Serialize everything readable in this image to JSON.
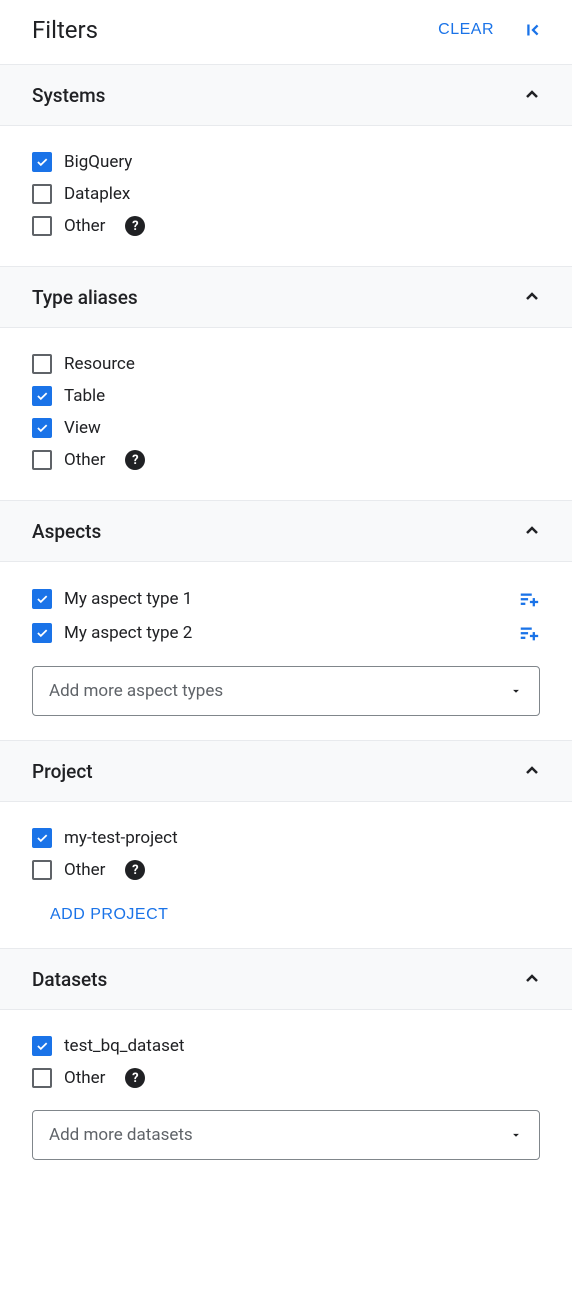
{
  "header": {
    "title": "Filters",
    "clear_label": "CLEAR"
  },
  "sections": {
    "systems": {
      "title": "Systems",
      "items": [
        {
          "label": "BigQuery",
          "checked": true
        },
        {
          "label": "Dataplex",
          "checked": false
        },
        {
          "label": "Other",
          "checked": false,
          "help": true
        }
      ]
    },
    "type_aliases": {
      "title": "Type aliases",
      "items": [
        {
          "label": "Resource",
          "checked": false
        },
        {
          "label": "Table",
          "checked": true
        },
        {
          "label": "View",
          "checked": true
        },
        {
          "label": "Other",
          "checked": false,
          "help": true
        }
      ]
    },
    "aspects": {
      "title": "Aspects",
      "items": [
        {
          "label": "My aspect type 1",
          "checked": true,
          "filter_action": true
        },
        {
          "label": "My aspect type 2",
          "checked": true,
          "filter_action": true
        }
      ],
      "dropdown_placeholder": "Add more aspect types"
    },
    "project": {
      "title": "Project",
      "items": [
        {
          "label": "my-test-project",
          "checked": true
        },
        {
          "label": "Other",
          "checked": false,
          "help": true
        }
      ],
      "add_label": "ADD PROJECT"
    },
    "datasets": {
      "title": "Datasets",
      "items": [
        {
          "label": "test_bq_dataset",
          "checked": true
        },
        {
          "label": "Other",
          "checked": false,
          "help": true
        }
      ],
      "dropdown_placeholder": "Add more datasets"
    }
  }
}
